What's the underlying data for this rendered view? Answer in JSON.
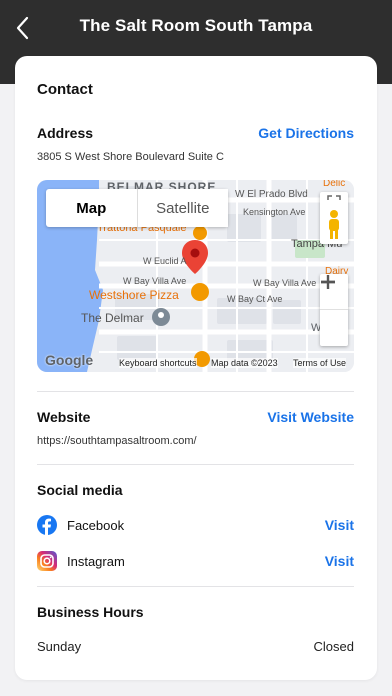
{
  "header": {
    "title": "The Salt Room South Tampa"
  },
  "contact": {
    "title": "Contact",
    "address_label": "Address",
    "directions_label": "Get Directions",
    "address": "3805 S West Shore Boulevard Suite C",
    "website_label": "Website",
    "visit_website_label": "Visit Website",
    "website_url": "https://southtampasaltroom.com/",
    "social_label": "Social media",
    "social": [
      {
        "name": "Facebook",
        "action": "Visit",
        "icon": "facebook-icon"
      },
      {
        "name": "Instagram",
        "action": "Visit",
        "icon": "instagram-icon"
      }
    ],
    "hours_label": "Business Hours",
    "hours": [
      {
        "day": "Sunday",
        "status": "Closed"
      }
    ]
  },
  "map": {
    "tab_map": "Map",
    "tab_satellite": "Satellite",
    "labels": {
      "belmar_shore": "BELMAR SHORE",
      "el_prado": "W El Prado Blvd",
      "kensington": "Kensington Ave",
      "trattoria": "Trattoria Pasquale",
      "tampa_mu": "Tampa Mu",
      "euclid": "W Euclid A",
      "dairy": "Dairy",
      "villa_ave_1": "W Bay Villa Ave",
      "villa_ave_2": "W Bay Villa Ave",
      "westshore_pizza": "Westshore Pizza",
      "bay_ct": "W Bay Ct Ave",
      "delmar": "The Delmar",
      "west_s": "WES",
      "deli": "Delic"
    },
    "google": "Google",
    "keyboard": "Keyboard shortcuts",
    "map_data": "Map data ©2023",
    "terms": "Terms of Use",
    "colors": {
      "water": "#8ab4f8",
      "park": "#c8e6c9",
      "pin": "#ea4335",
      "food": "#f29900"
    }
  },
  "colors": {
    "accent": "#1a73e8",
    "header_bg": "#2e2e2e",
    "page_bg": "#f2f2f4"
  }
}
